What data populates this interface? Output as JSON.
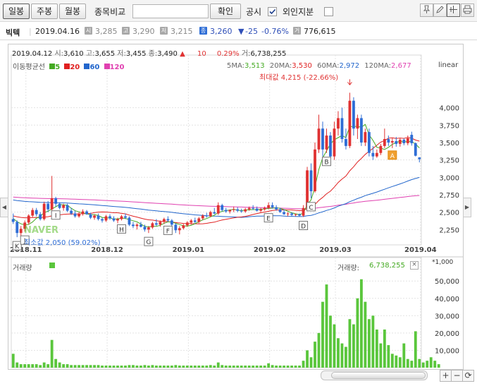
{
  "toolbar": {
    "tabs": [
      "일봉",
      "주봉",
      "월봉"
    ],
    "compare_label": "종목비교",
    "compare_value": "",
    "confirm_label": "확인",
    "notice_label": "공시",
    "foreign_label": "외인지분",
    "notice_checked": true,
    "foreign_checked": false
  },
  "info": {
    "name": "빅텍",
    "date": "2019.04.16",
    "open": "3,285",
    "high": "3,290",
    "low": "3,215",
    "close": "3,260",
    "change": "-25",
    "change_pct": "-0.76%",
    "volume": "776,615",
    "labels": {
      "open": "시",
      "high": "고",
      "low": "저",
      "close": "종",
      "volume": "거"
    }
  },
  "chart": {
    "ohlc_line": {
      "date": "2019.04.12",
      "open_label": "시:",
      "open": "3,610",
      "high_label": "고:",
      "high": "3,655",
      "low_label": "저:",
      "low": "3,455",
      "close_label": "종:",
      "close": "3,490",
      "change": "10",
      "change_pct": "0.29%",
      "volume_label": "거:",
      "volume": "6,738,255"
    },
    "ma_legend": {
      "title": "이동평균선",
      "items": [
        "5",
        "20",
        "60",
        "120"
      ]
    },
    "ma_values": {
      "ma5_label": "5MA:",
      "ma5": "3,513",
      "ma20_label": "20MA:",
      "ma20": "3,530",
      "ma60_label": "60MA:",
      "ma60": "2,972",
      "ma120_label": "120MA:",
      "ma120": "2,677"
    },
    "scale_label": "linear",
    "max_label": "최대값 4,215 (-22.66%)",
    "min_label": "최소값 2,050 (59.02%)",
    "watermark": "NAVER",
    "volume_title": "거래량",
    "volume_label": "거래량:",
    "volume_value": "6,738,255",
    "volume_unit": "*1,000",
    "colors": {
      "up": "#e03232",
      "down": "#2f6ed6",
      "ma5": "#44aa22",
      "ma20": "#e02020",
      "ma60": "#2266cc",
      "ma120": "#e040b0",
      "volume": "#5ac63c"
    }
  },
  "chart_data": {
    "type": "candlestick",
    "x_tick_labels": [
      "2018.11",
      "2018.12",
      "2019.01",
      "2019.02",
      "2019.03",
      "2019.04"
    ],
    "y_tick_labels": [
      "2,250",
      "2,500",
      "2,750",
      "3,000",
      "3,250",
      "3,500",
      "3,750",
      "4,000"
    ],
    "ylim": [
      2050,
      4300
    ],
    "volume_tick_labels": [
      "10,000",
      "20,000",
      "30,000",
      "40,000",
      "50,000"
    ],
    "volume_ylim": [
      0,
      57000
    ],
    "markers": [
      "K",
      "J",
      "I",
      "H",
      "G",
      "F",
      "E",
      "D",
      "C",
      "B",
      "A"
    ],
    "candles": [
      [
        2400,
        2480,
        2330,
        2360
      ],
      [
        2360,
        2380,
        2140,
        2200
      ],
      [
        2200,
        2300,
        2150,
        2260
      ],
      [
        2260,
        2380,
        2220,
        2350
      ],
      [
        2350,
        2470,
        2320,
        2450
      ],
      [
        2450,
        2560,
        2420,
        2530
      ],
      [
        2530,
        2560,
        2440,
        2470
      ],
      [
        2470,
        2500,
        2380,
        2400
      ],
      [
        2400,
        2650,
        2380,
        2620
      ],
      [
        2620,
        2660,
        2500,
        2540
      ],
      [
        2540,
        3020,
        2520,
        2700
      ],
      [
        2700,
        2720,
        2580,
        2620
      ],
      [
        2620,
        2640,
        2540,
        2560
      ],
      [
        2560,
        2620,
        2520,
        2600
      ],
      [
        2600,
        2620,
        2500,
        2520
      ],
      [
        2520,
        2560,
        2460,
        2480
      ],
      [
        2480,
        2520,
        2420,
        2440
      ],
      [
        2440,
        2500,
        2420,
        2480
      ],
      [
        2480,
        2540,
        2450,
        2510
      ],
      [
        2510,
        2530,
        2460,
        2470
      ],
      [
        2470,
        2490,
        2400,
        2420
      ],
      [
        2420,
        2470,
        2390,
        2450
      ],
      [
        2450,
        2480,
        2380,
        2400
      ],
      [
        2400,
        2420,
        2350,
        2380
      ],
      [
        2380,
        2460,
        2360,
        2440
      ],
      [
        2440,
        2470,
        2390,
        2410
      ],
      [
        2410,
        2440,
        2360,
        2380
      ],
      [
        2380,
        2420,
        2340,
        2400
      ],
      [
        2400,
        2460,
        2380,
        2440
      ],
      [
        2440,
        2480,
        2400,
        2420
      ],
      [
        2420,
        2440,
        2300,
        2320
      ],
      [
        2320,
        2360,
        2270,
        2300
      ],
      [
        2300,
        2340,
        2250,
        2320
      ],
      [
        2320,
        2360,
        2280,
        2290
      ],
      [
        2290,
        2320,
        2220,
        2250
      ],
      [
        2250,
        2300,
        2200,
        2280
      ],
      [
        2280,
        2360,
        2260,
        2340
      ],
      [
        2340,
        2400,
        2300,
        2320
      ],
      [
        2320,
        2380,
        2290,
        2360
      ],
      [
        2360,
        2420,
        2330,
        2400
      ],
      [
        2400,
        2440,
        2360,
        2380
      ],
      [
        2380,
        2400,
        2300,
        2320
      ],
      [
        2320,
        2340,
        2200,
        2240
      ],
      [
        2240,
        2300,
        2180,
        2270
      ],
      [
        2270,
        2330,
        2250,
        2310
      ],
      [
        2310,
        2370,
        2290,
        2350
      ],
      [
        2350,
        2400,
        2320,
        2380
      ],
      [
        2380,
        2420,
        2340,
        2360
      ],
      [
        2360,
        2430,
        2340,
        2410
      ],
      [
        2410,
        2470,
        2390,
        2450
      ],
      [
        2450,
        2490,
        2420,
        2440
      ],
      [
        2440,
        2520,
        2430,
        2500
      ],
      [
        2500,
        2560,
        2470,
        2480
      ],
      [
        2480,
        2640,
        2460,
        2600
      ],
      [
        2600,
        2620,
        2510,
        2530
      ],
      [
        2530,
        2560,
        2490,
        2510
      ],
      [
        2510,
        2540,
        2480,
        2530
      ],
      [
        2530,
        2580,
        2500,
        2540
      ],
      [
        2540,
        2570,
        2500,
        2520
      ],
      [
        2520,
        2550,
        2490,
        2510
      ],
      [
        2510,
        2560,
        2490,
        2540
      ],
      [
        2540,
        2580,
        2520,
        2560
      ],
      [
        2560,
        2600,
        2530,
        2550
      ],
      [
        2550,
        2580,
        2510,
        2520
      ],
      [
        2520,
        2560,
        2500,
        2540
      ],
      [
        2540,
        2580,
        2520,
        2560
      ],
      [
        2560,
        2640,
        2540,
        2600
      ],
      [
        2600,
        2640,
        2550,
        2570
      ],
      [
        2570,
        2600,
        2520,
        2540
      ],
      [
        2540,
        2560,
        2490,
        2500
      ],
      [
        2500,
        2540,
        2460,
        2470
      ],
      [
        2470,
        2500,
        2440,
        2480
      ],
      [
        2480,
        2500,
        2440,
        2460
      ],
      [
        2460,
        2480,
        2440,
        2470
      ],
      [
        2470,
        2480,
        2440,
        2450
      ],
      [
        2450,
        2600,
        2430,
        2560
      ],
      [
        2560,
        3150,
        2540,
        3100
      ],
      [
        3100,
        3200,
        2700,
        2800
      ],
      [
        2800,
        3500,
        2780,
        3400
      ],
      [
        3400,
        3900,
        3350,
        3700
      ],
      [
        3700,
        3800,
        3300,
        3400
      ],
      [
        3400,
        3700,
        3350,
        3600
      ],
      [
        3600,
        3650,
        3200,
        3300
      ],
      [
        3300,
        3800,
        3250,
        3700
      ],
      [
        3700,
        3950,
        3600,
        3850
      ],
      [
        3850,
        4000,
        3500,
        3550
      ],
      [
        3550,
        3700,
        3400,
        3450
      ],
      [
        3450,
        4215,
        3420,
        4100
      ],
      [
        4100,
        4150,
        3600,
        3700
      ],
      [
        3700,
        3900,
        3550,
        3850
      ],
      [
        3850,
        3900,
        3450,
        3500
      ],
      [
        3500,
        3700,
        3450,
        3650
      ],
      [
        3650,
        3700,
        3300,
        3350
      ],
      [
        3350,
        3450,
        3250,
        3300
      ],
      [
        3300,
        3400,
        3280,
        3350
      ],
      [
        3350,
        3480,
        3320,
        3450
      ],
      [
        3450,
        3700,
        3420,
        3550
      ],
      [
        3550,
        3600,
        3450,
        3500
      ],
      [
        3500,
        3560,
        3420,
        3520
      ],
      [
        3520,
        3580,
        3440,
        3480
      ],
      [
        3480,
        3560,
        3440,
        3540
      ],
      [
        3540,
        3560,
        3460,
        3490
      ],
      [
        3490,
        3600,
        3460,
        3560
      ],
      [
        3610,
        3655,
        3455,
        3490
      ],
      [
        3490,
        3500,
        3300,
        3310
      ],
      [
        3285,
        3290,
        3215,
        3260
      ]
    ],
    "volume": [
      8000,
      3000,
      2000,
      2000,
      2000,
      2000,
      2000,
      1500,
      3000,
      2000,
      16000,
      5000,
      3000,
      2000,
      2000,
      1500,
      1500,
      1500,
      1500,
      1500,
      1500,
      1500,
      1500,
      1200,
      1200,
      1200,
      1200,
      1200,
      1200,
      1200,
      1500,
      1500,
      1200,
      1200,
      1500,
      1200,
      1500,
      1200,
      1200,
      1200,
      1200,
      1200,
      1500,
      1200,
      1200,
      1200,
      1200,
      1200,
      1200,
      1200,
      1200,
      1500,
      1200,
      3000,
      1500,
      1200,
      1200,
      1200,
      1200,
      1200,
      1200,
      1200,
      1200,
      1200,
      1200,
      1200,
      2500,
      1500,
      1200,
      1200,
      1200,
      1200,
      1200,
      1200,
      1200,
      4000,
      10000,
      6000,
      15000,
      20000,
      38000,
      48000,
      30000,
      25000,
      17000,
      14000,
      12000,
      28000,
      25000,
      40000,
      51000,
      38000,
      28000,
      30000,
      22000,
      14000,
      22000,
      13000,
      8000,
      7000,
      6000,
      14000,
      5000,
      4000,
      21000,
      5000,
      3000,
      4000,
      6000,
      4000,
      2000
    ]
  }
}
